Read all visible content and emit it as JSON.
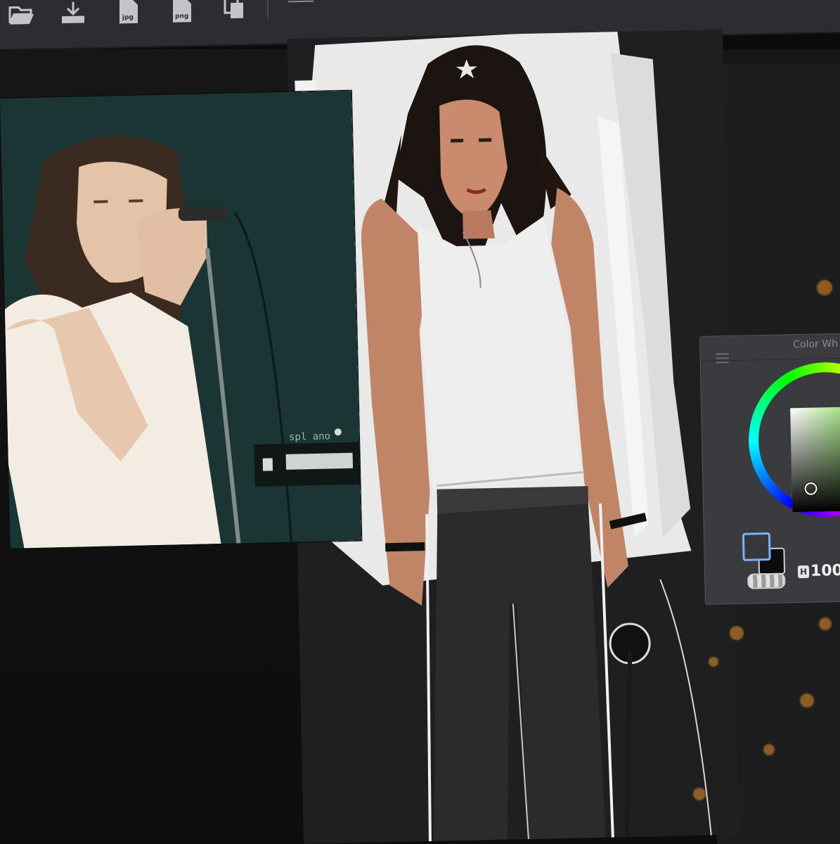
{
  "toolbar": {
    "icons": [
      "open-folder-icon",
      "download-icon",
      "export-jpg-icon",
      "export-png-icon",
      "copy-icon"
    ],
    "jpg_label": "jpg",
    "png_label": "png"
  },
  "reference_photo": {
    "amp_label": "spl ano"
  },
  "color_panel": {
    "title": "Color Wh",
    "h_badge": "H",
    "opacity_value": "100",
    "foreground_color": "#36373b",
    "background_color": "#0d0d0d"
  },
  "colors": {
    "toolbar_bg": "#2c2d30",
    "workspace_bg": "#101011",
    "panel_bg": "#3a3b3f",
    "accent_selection": "#7fb0ff"
  }
}
